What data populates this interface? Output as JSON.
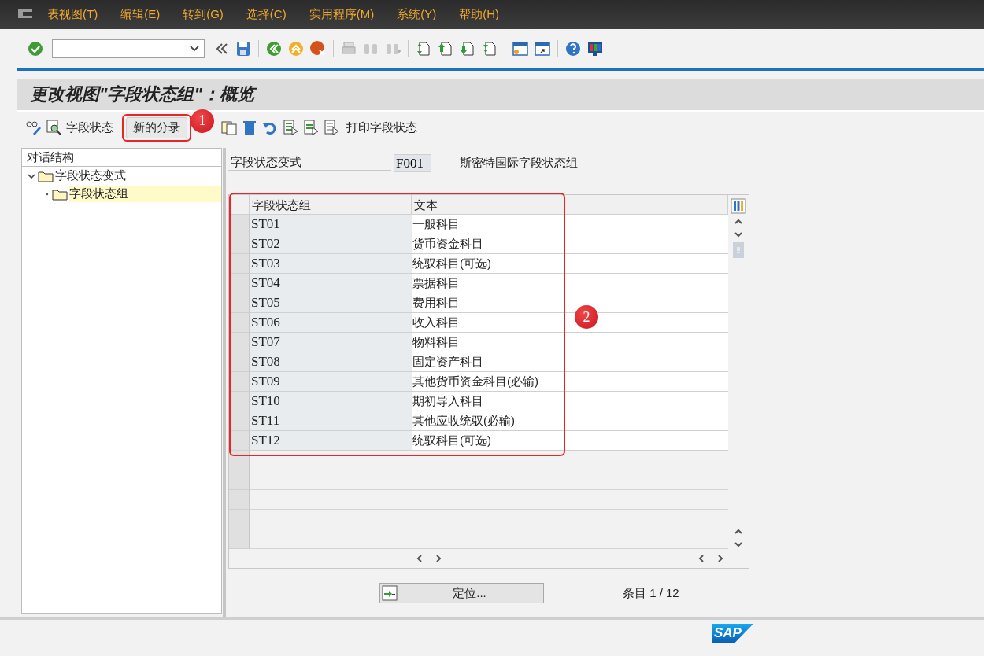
{
  "menu": [
    "表视图(T)",
    "编辑(E)",
    "转到(G)",
    "选择(C)",
    "实用程序(M)",
    "系统(Y)",
    "帮助(H)"
  ],
  "title": "更改视图\"字段状态组\"：概览",
  "app_toolbar": {
    "field_status": "字段状态",
    "new_entries": "新的分录",
    "print": "打印字段状态"
  },
  "tree": {
    "title": "对话结构",
    "items": [
      {
        "label": "字段状态变式",
        "expanded": true,
        "selected": false,
        "children": [
          {
            "label": "字段状态组",
            "selected": true
          }
        ]
      }
    ]
  },
  "variant": {
    "label": "字段状态变式",
    "value": "F001",
    "description": "斯密特国际字段状态组"
  },
  "table": {
    "columns": [
      "字段状态组",
      "文本"
    ],
    "rows": [
      {
        "group": "ST01",
        "text": "一般科目"
      },
      {
        "group": "ST02",
        "text": "货币资金科目"
      },
      {
        "group": "ST03",
        "text": "统驭科目(可选)"
      },
      {
        "group": "ST04",
        "text": "票据科目"
      },
      {
        "group": "ST05",
        "text": "费用科目"
      },
      {
        "group": "ST06",
        "text": "收入科目"
      },
      {
        "group": "ST07",
        "text": "物料科目"
      },
      {
        "group": "ST08",
        "text": "固定资产科目"
      },
      {
        "group": "ST09",
        "text": "其他货币资金科目(必输)"
      },
      {
        "group": "ST10",
        "text": "期初导入科目"
      },
      {
        "group": "ST11",
        "text": "其他应收统驭(必输)"
      },
      {
        "group": "ST12",
        "text": "统驭科目(可选)"
      }
    ]
  },
  "position_button": "定位...",
  "entry_count": "条目 1 / 12",
  "logo": "SAP",
  "annotations": [
    {
      "label": "1"
    },
    {
      "label": "2"
    }
  ]
}
